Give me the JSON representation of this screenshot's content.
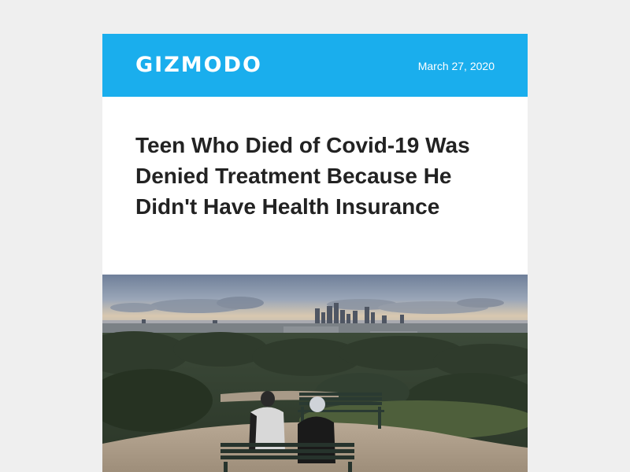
{
  "header": {
    "logo_text": "GIZMODO",
    "date": "March 27, 2020",
    "background_color": "#1aaeed"
  },
  "article": {
    "headline": "Teen Who Died of Covid-19 Was Denied Treatment Because He Didn't Have Health Insurance"
  }
}
